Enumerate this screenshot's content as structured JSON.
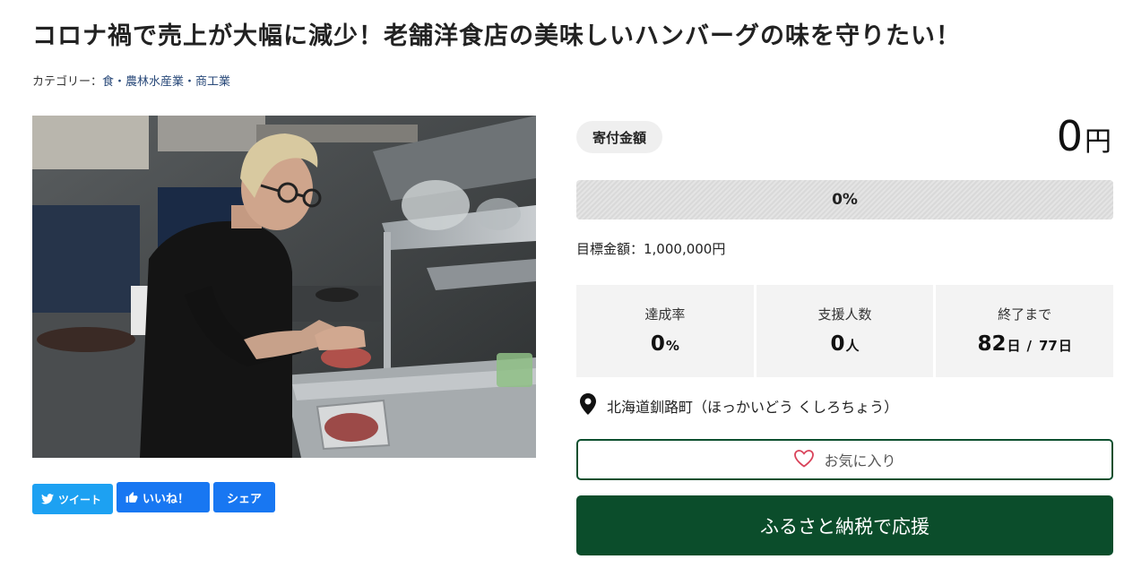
{
  "page": {
    "title": "コロナ禍で売上が大幅に減少！老舗洋食店の美味しいハンバーグの味を守りたい！"
  },
  "category": {
    "label": "カテゴリー：",
    "items": "食・農林水産業・商工業"
  },
  "photo": {
    "icon": "chef-preparing-hamburger-photo"
  },
  "social": {
    "tweet_label": "ツイート",
    "like_label": "いいね！",
    "share_label": "シェア",
    "colors": {
      "twitter": "#1da1f2",
      "facebook": "#1877f2"
    }
  },
  "donation": {
    "amount_label": "寄付金額",
    "amount_value": "0",
    "amount_unit": "円",
    "progress_fraction": 0,
    "progress_text": "0%",
    "goal_text": "目標金額：1,000,000円"
  },
  "stats": {
    "rate_label": "達成率",
    "rate_value": "0",
    "rate_unit": "%",
    "supporters_label": "支援人数",
    "supporters_value": "0",
    "supporters_unit": "人",
    "remaining_label": "終了まで",
    "remaining_value": "82",
    "remaining_unit": "日",
    "remaining_sep": "/",
    "total_value": "77",
    "total_unit": "日"
  },
  "location": {
    "icon": "map-pin-icon",
    "text": "北海道釧路町（ほっかいどう くしろちょう）"
  },
  "actions": {
    "favorite_label": "お気に入り",
    "support_label": "ふるさと納税で応援"
  },
  "colors": {
    "accent_green": "#0b4d2b",
    "favorite_heart": "#d9435a"
  }
}
